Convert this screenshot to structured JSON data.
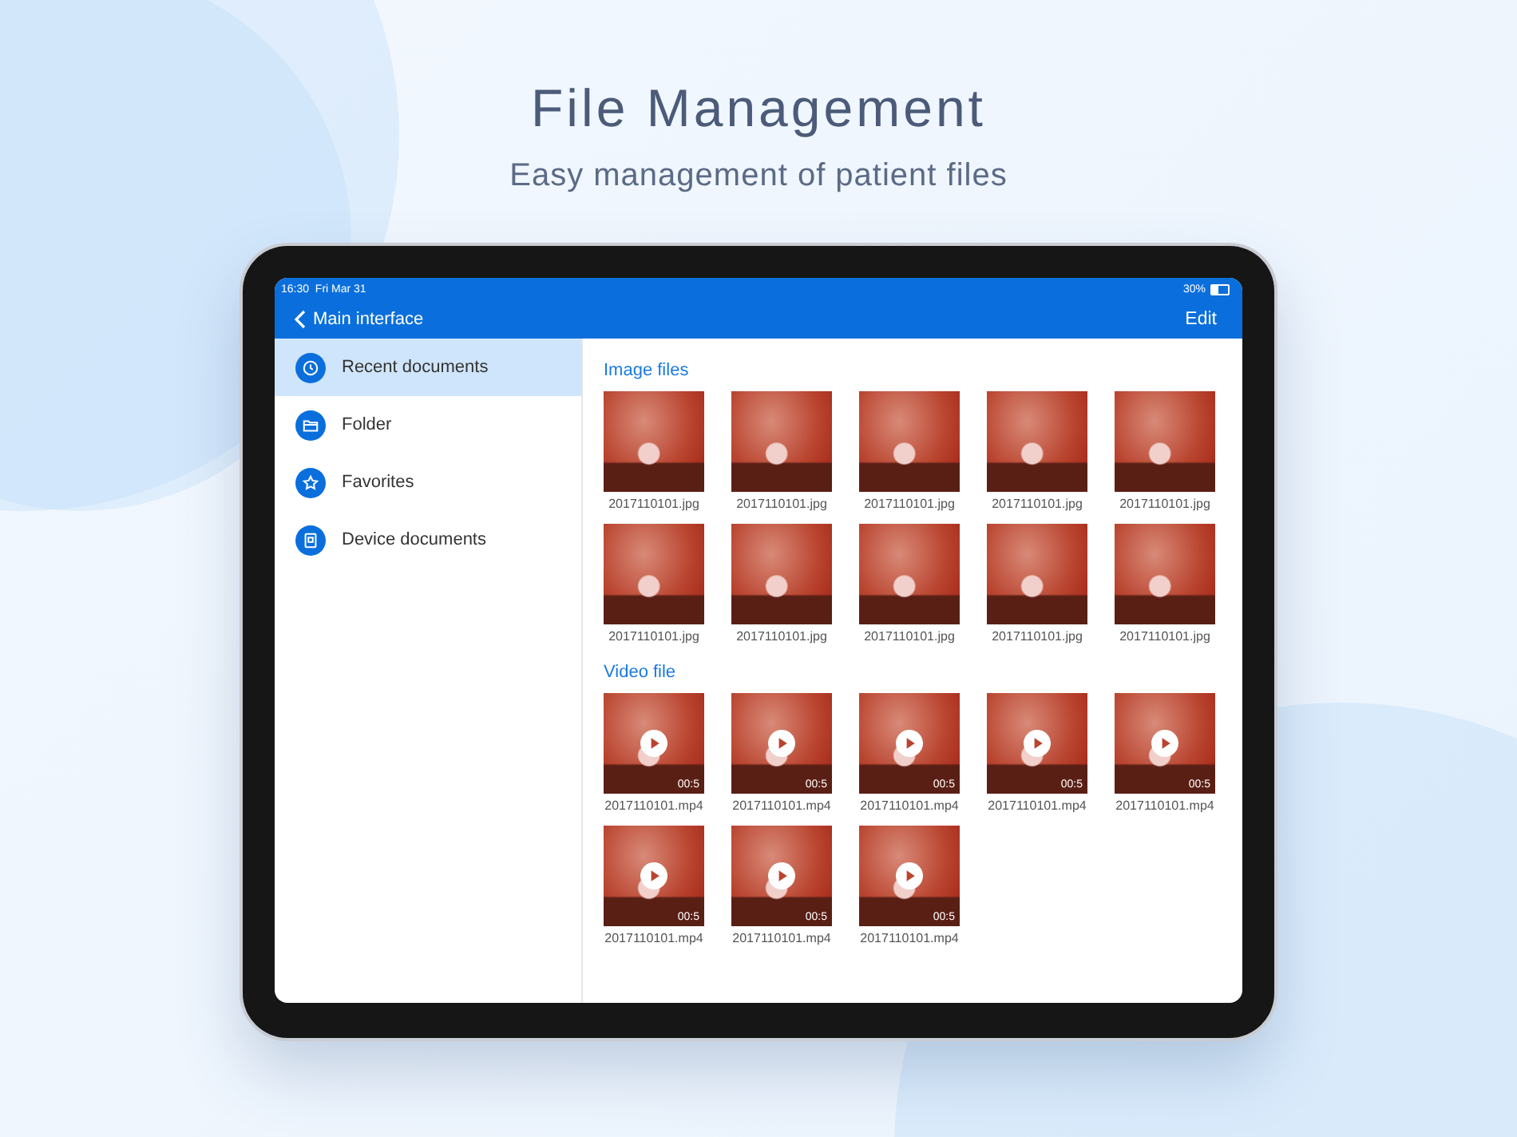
{
  "header": {
    "title": "File Management",
    "subtitle": "Easy management of patient files"
  },
  "status_bar": {
    "time": "16:30",
    "date": "Fri Mar 31",
    "battery": "30%"
  },
  "nav": {
    "back": "Main interface",
    "action": "Edit"
  },
  "sidebar": {
    "items": [
      {
        "label": "Recent documents",
        "selected": true
      },
      {
        "label": "Folder",
        "selected": false
      },
      {
        "label": "Favorites",
        "selected": false
      },
      {
        "label": "Device documents",
        "selected": false
      }
    ]
  },
  "sections": [
    {
      "title": "Image files",
      "kind": "image",
      "files": [
        {
          "name": "2017110101.jpg"
        },
        {
          "name": "2017110101.jpg"
        },
        {
          "name": "2017110101.jpg"
        },
        {
          "name": "2017110101.jpg"
        },
        {
          "name": "2017110101.jpg"
        },
        {
          "name": "2017110101.jpg"
        },
        {
          "name": "2017110101.jpg"
        },
        {
          "name": "2017110101.jpg"
        },
        {
          "name": "2017110101.jpg"
        },
        {
          "name": "2017110101.jpg"
        }
      ]
    },
    {
      "title": "Video file",
      "kind": "video",
      "files": [
        {
          "name": "2017110101.mp4",
          "duration": "00:5"
        },
        {
          "name": "2017110101.mp4",
          "duration": "00:5"
        },
        {
          "name": "2017110101.mp4",
          "duration": "00:5"
        },
        {
          "name": "2017110101.mp4",
          "duration": "00:5"
        },
        {
          "name": "2017110101.mp4",
          "duration": "00:5"
        },
        {
          "name": "2017110101.mp4",
          "duration": "00:5"
        },
        {
          "name": "2017110101.mp4",
          "duration": "00:5"
        },
        {
          "name": "2017110101.mp4",
          "duration": "00:5"
        }
      ]
    }
  ]
}
